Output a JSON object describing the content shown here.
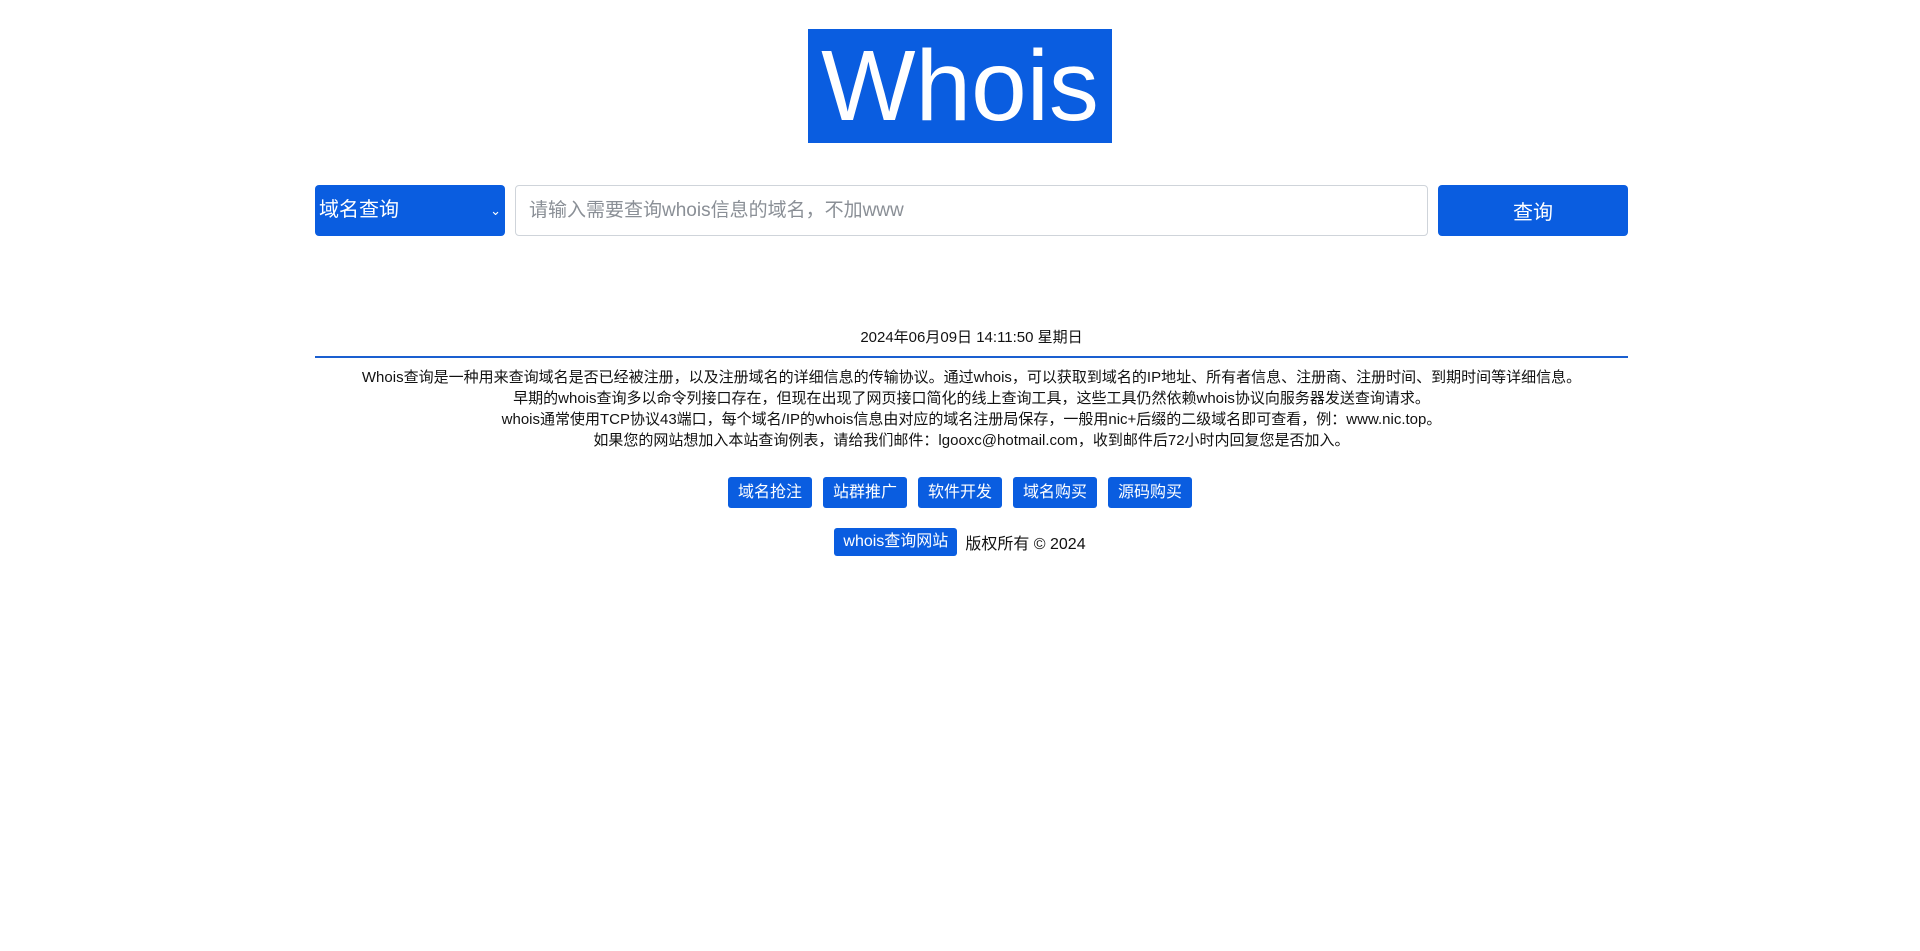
{
  "logo": {
    "text": "Whois"
  },
  "search": {
    "type_selected": "域名查询",
    "placeholder": "请输入需要查询whois信息的域名，不加www",
    "value": "",
    "button_label": "查询"
  },
  "datetime": "2024年06月09日 14:11:50 星期日",
  "intro": {
    "line1": "Whois查询是一种用来查询域名是否已经被注册，以及注册域名的详细信息的传输协议。通过whois，可以获取到域名的IP地址、所有者信息、注册商、注册时间、到期时间等详细信息。",
    "line2": "早期的whois查询多以命令列接口存在，但现在出现了网页接口简化的线上查询工具，这些工具仍然依赖whois协议向服务器发送查询请求。",
    "line3": "whois通常使用TCP协议43端口，每个域名/IP的whois信息由对应的域名注册局保存，一般用nic+后缀的二级域名即可查看，例：www.nic.top。",
    "line4": "如果您的网站想加入本站查询例表，请给我们邮件：lgooxc@hotmail.com，收到邮件后72小时内回复您是否加入。"
  },
  "links": [
    {
      "label": "域名抢注"
    },
    {
      "label": "站群推广"
    },
    {
      "label": "软件开发"
    },
    {
      "label": "域名购买"
    },
    {
      "label": "源码购买"
    }
  ],
  "footer": {
    "brand": "whois查询网站",
    "copyright": "版权所有 © 2024"
  },
  "colors": {
    "accent": "#0a5de0",
    "divider": "#1a5fd0"
  }
}
